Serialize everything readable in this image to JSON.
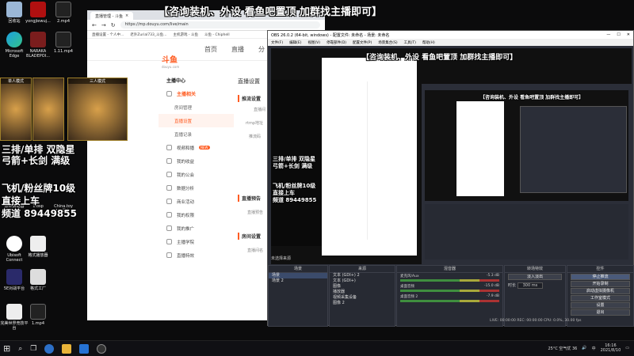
{
  "banner": "【咨询装机、外设 看鱼吧置顶 加群找主播即可】",
  "desktop_icons": [
    {
      "label": "回收站"
    },
    {
      "label": "yongjiewuj..."
    },
    {
      "label": "2.mp4"
    },
    {
      "label": "Microsoft Edge"
    },
    {
      "label": "NARAKA BLADEPOI..."
    },
    {
      "label": "1.11.mp4"
    },
    {
      "label": "Ubisoft Connect"
    },
    {
      "label": "格式播放器"
    },
    {
      "label": "5E对战平台"
    },
    {
      "label": "格式工厂"
    },
    {
      "label": "完美世界竞技平台"
    },
    {
      "label": "1.mp4"
    }
  ],
  "ads": {
    "card1": "单人模式",
    "card2": "三人模式",
    "line1": "三排/单排  双隐星",
    "line2": "弓箭+长剑 满级",
    "line3": "飞机/粉丝牌10级",
    "line4": "直接上车",
    "line5": "频道 89449855"
  },
  "desktop_extra": [
    {
      "label": "原神启动器"
    },
    {
      "label": "1.osp"
    },
    {
      "label": "China.toy AMD显卡..."
    }
  ],
  "browser": {
    "tabs": [
      "直播管理 - 斗鱼"
    ],
    "url": "https://mp.douyu.com/live/main",
    "bookmarks": [
      "直播设置 - 个人中...",
      "老外Zurial733_斗鱼...",
      "主机游戏 - 斗鱼",
      "斗鱼 - Chiphell"
    ],
    "logo": "斗鱼",
    "logo_sub": "douyu.com",
    "nav": [
      "首页",
      "直播",
      "分"
    ],
    "sidebar": [
      {
        "label": "主播中心",
        "type": "hd"
      },
      {
        "label": "主播相关",
        "type": "hd-act"
      },
      {
        "label": "房间管理",
        "type": "sub"
      },
      {
        "label": "直播设置",
        "type": "sub-act"
      },
      {
        "label": "直播记录",
        "type": "sub"
      },
      {
        "label": "视频和播",
        "type": "it"
      },
      {
        "label": "我的收益",
        "type": "it"
      },
      {
        "label": "我的公会",
        "type": "it"
      },
      {
        "label": "数据分析",
        "type": "it"
      },
      {
        "label": "商业活动",
        "type": "it"
      },
      {
        "label": "我的权限",
        "type": "it"
      },
      {
        "label": "我的推广",
        "type": "it"
      },
      {
        "label": "主播学院",
        "type": "it"
      },
      {
        "label": "直播特效",
        "type": "it"
      }
    ],
    "badge": "NEW",
    "main_title": "直播设置",
    "push_title": "推流设置",
    "push_rows": [
      "直播间",
      "rtmp地址",
      "推流码"
    ],
    "preview_title": "直播预告",
    "preview_row": "直播预告",
    "room_title": "房间设置",
    "room_row": "直播间名"
  },
  "obs": {
    "title": "OBS 26.0.2 (64-bit, windows) - 配置文件: 未命名 - 场景: 未命名",
    "menu": [
      "文件(F)",
      "编辑(E)",
      "视图(V)",
      "停靠部件(D)",
      "配置文件(P)",
      "场景集合(S)",
      "工具(T)",
      "帮助(H)"
    ],
    "dock_titles": [
      "场景",
      "来源",
      "混音器",
      "转场特效",
      "控件"
    ],
    "scene_label_current": "未选择来源",
    "scenes": [
      "场景",
      "场景 2"
    ],
    "sources": [
      "文本 (GDI+) 2",
      "文本 (GDI+)",
      "图像",
      "播放器",
      "视频采集设备",
      "图像 2"
    ],
    "mixer": [
      {
        "name": "麦克风/Aux",
        "db": "-5.3 dB"
      },
      {
        "name": "桌面音频",
        "db": "-15.0 dB"
      },
      {
        "name": "桌面音频 2",
        "db": "-7.9 dB"
      }
    ],
    "transition": "淡入淡出",
    "duration_label": "时长",
    "duration": "300 ms",
    "controls": [
      "停止推流",
      "开始录制",
      "启动虚拟摄像机",
      "工作室模式",
      "设置",
      "退出"
    ],
    "status": "LIVE: 00:00:00  REC: 00:00:00  CPU: 0.0%, 30.00 fps"
  },
  "taskbar": {
    "weather": "25°C 空气优 36",
    "time": "16:16",
    "date": "2021/8/10",
    "lang": "中"
  }
}
